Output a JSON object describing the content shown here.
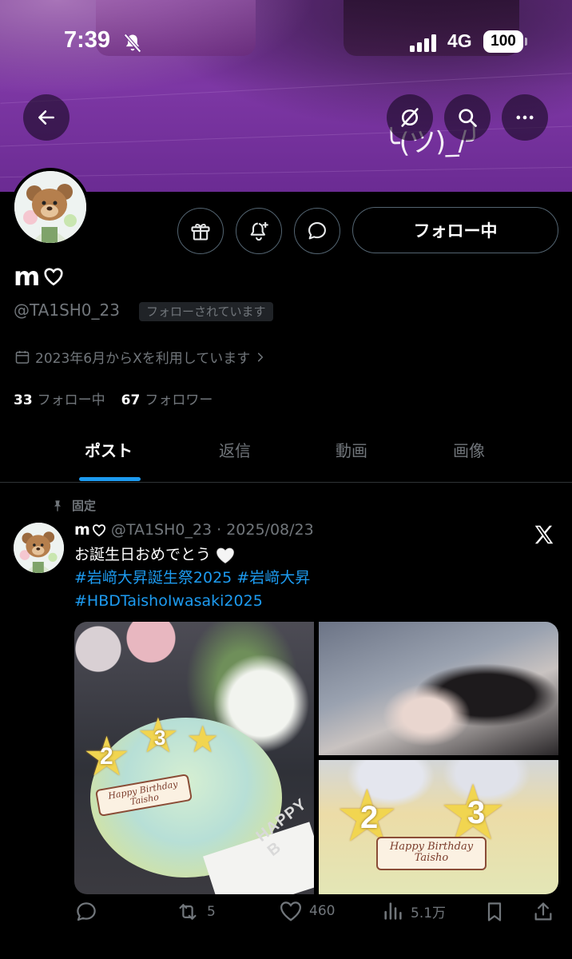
{
  "status_bar": {
    "time": "7:39",
    "network": "4G",
    "battery": "100"
  },
  "banner": {
    "kaomoji": "╰(ツ)_/╯"
  },
  "profile": {
    "display_name": "m",
    "handle": "@TA1SH0_23",
    "follows_you": "フォローされています",
    "following_button": "フォロー中",
    "joined": "2023年6月からXを利用しています",
    "following_count": "33",
    "following_label": "フォロー中",
    "followers_count": "67",
    "followers_label": "フォロワー"
  },
  "tabs": [
    {
      "label": "ポスト",
      "active": true
    },
    {
      "label": "返信",
      "active": false
    },
    {
      "label": "動画",
      "active": false
    },
    {
      "label": "画像",
      "active": false
    }
  ],
  "post": {
    "pinned_label": "固定",
    "author_name": "m",
    "author_handle": "@TA1SH0_23",
    "date": "2025/08/23",
    "separator": "·",
    "text": "お誕生日おめでとう",
    "hashtags_line1": [
      "#岩﨑大昇誕生祭2025",
      "#岩﨑大昇"
    ],
    "hashtags_line2": [
      "#HBDTaishoIwasaki2025"
    ],
    "media": {
      "plaque_line1": "Happy Birthday",
      "plaque_line2": "Taisho",
      "star_digit_1": "2",
      "star_digit_2": "3",
      "plate_text": "HAPPY B"
    },
    "actions": {
      "reply_count": "",
      "repost_count": "5",
      "like_count": "460",
      "view_count": "5.1万"
    }
  },
  "colors": {
    "accent": "#1d9bf0",
    "muted": "#71767b",
    "border": "#536471",
    "background": "#000000"
  }
}
